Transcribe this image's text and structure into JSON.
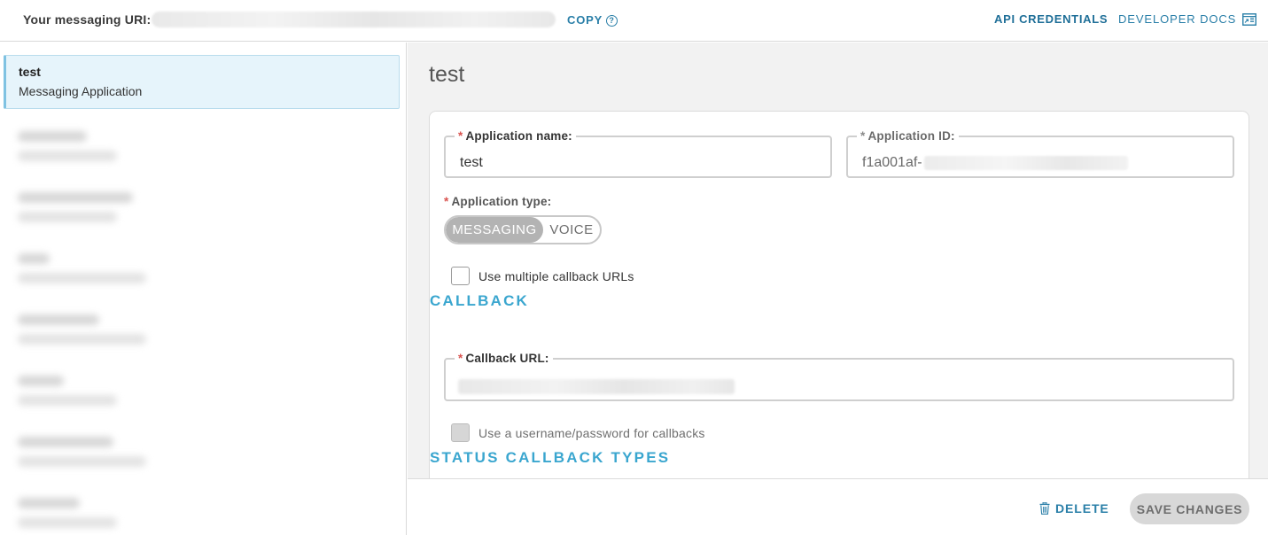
{
  "topbar": {
    "uri_label": "Your messaging URI:",
    "copy_label": "COPY",
    "help_icon": "question-circle-icon",
    "api_credentials": "API CREDENTIALS",
    "developer_docs": "DEVELOPER DOCS",
    "docs_icon": "external-docs-icon"
  },
  "sidebar": {
    "active_item": {
      "name": "test",
      "type": "Messaging Application"
    },
    "other_items_count_note": "blurred"
  },
  "main": {
    "title": "test",
    "application_name": {
      "label": "Application name:",
      "value": "test",
      "required_marker": "*"
    },
    "application_id": {
      "label": "Application ID:",
      "value_prefix": "f1a001af-",
      "required_marker": "*"
    },
    "application_type": {
      "label": "Application type:",
      "required_marker": "*",
      "options": [
        "MESSAGING",
        "VOICE"
      ],
      "selected": "MESSAGING"
    },
    "multiple_callbacks": {
      "label": "Use multiple callback URLs",
      "checked": false
    },
    "callback_section_title": "CALLBACK",
    "callback_url": {
      "label": "Callback URL:",
      "required_marker": "*"
    },
    "callback_auth": {
      "label": "Use a username/password for callbacks",
      "checked": false,
      "disabled": true
    },
    "status_callback_section_title": "STATUS CALLBACK TYPES"
  },
  "footer": {
    "delete_label": "DELETE",
    "delete_icon": "trash-icon",
    "save_label": "SAVE CHANGES"
  },
  "colors": {
    "accent": "#2a7fa8",
    "section_title": "#3aa6cf",
    "required": "#d9534f",
    "active_item_bg": "#e6f4fb"
  }
}
